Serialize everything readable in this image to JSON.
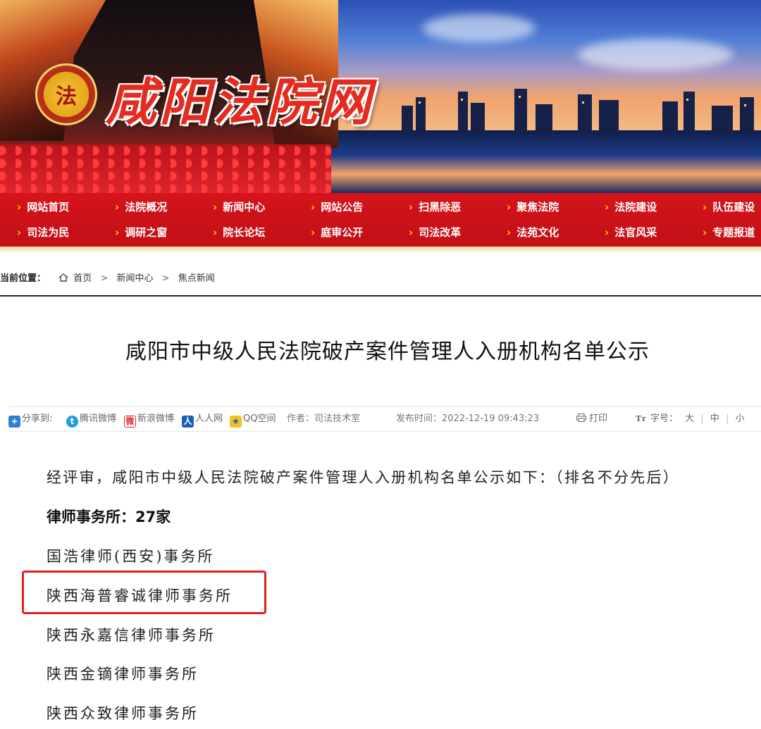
{
  "header": {
    "site_title": "咸阳法院网",
    "emblem_glyph": "法"
  },
  "nav": {
    "row1": [
      "网站首页",
      "法院概况",
      "新闻中心",
      "网站公告",
      "扫黑除恶",
      "聚焦法院",
      "法院建设",
      "队伍建设"
    ],
    "row2": [
      "司法为民",
      "调研之窗",
      "院长论坛",
      "庭审公开",
      "司法改革",
      "法苑文化",
      "法官风采",
      "专题报道"
    ],
    "arrow": "›"
  },
  "breadcrumb": {
    "label": "当前位置：",
    "items": [
      "首页",
      "新闻中心",
      "焦点新闻"
    ],
    "separator": ">"
  },
  "article": {
    "title": "咸阳市中级人民法院破产案件管理人入册机构名单公示",
    "share_label": "分享到:",
    "share_targets": [
      "腾讯微博",
      "新浪微博",
      "人人网",
      "QQ空间"
    ],
    "author": "作者：司法技术室",
    "published": "发布时间：2022-12-19 09:43:23",
    "print_label": "打印",
    "font_size_label": "字号：",
    "font_sizes": [
      "大",
      "中",
      "小"
    ],
    "intro": "经评审，咸阳市中级人民法院破产案件管理人入册机构名单公示如下：（排名不分先后）",
    "section_heading": "律师事务所：27家",
    "firms": [
      "国浩律师(西安)事务所",
      "陕西海普睿诚律师事务所",
      "陕西永嘉信律师事务所",
      "陕西金镝律师事务所",
      "陕西众致律师事务所"
    ],
    "highlighted_firm_index": 1
  },
  "colors": {
    "nav_red": "#d5141b",
    "nav_arrow": "#ffd200",
    "highlight_border": "#e41f1f"
  }
}
